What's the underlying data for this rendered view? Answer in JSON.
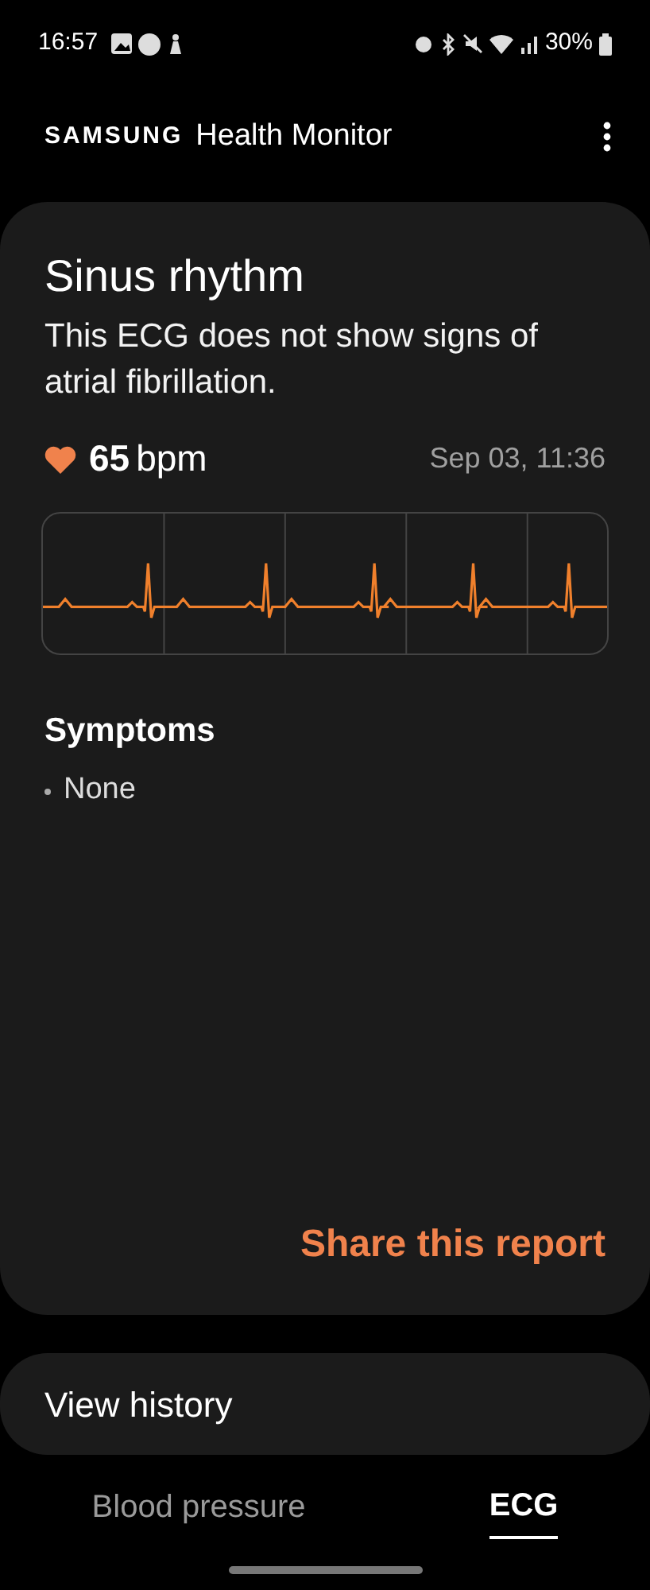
{
  "status_bar": {
    "time": "16:57",
    "battery_text": "30%"
  },
  "app_bar": {
    "brand": "SAMSUNG",
    "title": "Health Monitor"
  },
  "result": {
    "title": "Sinus rhythm",
    "description": "This ECG does not show signs of atrial fibrillation.",
    "heart_rate": "65",
    "unit": "bpm",
    "timestamp": "Sep 03, 11:36",
    "symptoms_title": "Symptoms",
    "symptoms": [
      "None"
    ],
    "share": "Share this report"
  },
  "history": {
    "label": "View history"
  },
  "tabs": [
    {
      "label": "Blood pressure",
      "selected": false
    },
    {
      "label": "ECG",
      "selected": true
    }
  ]
}
